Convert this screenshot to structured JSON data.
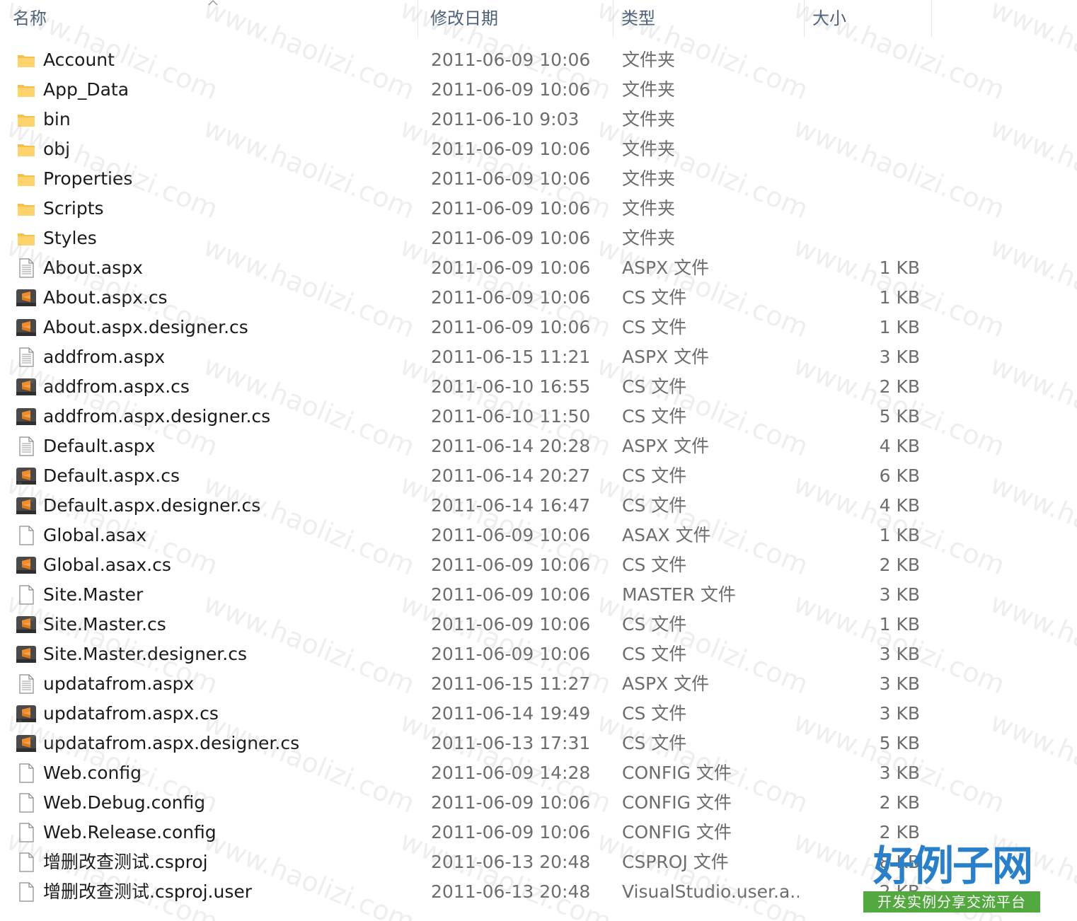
{
  "header": {
    "name": "名称",
    "date": "修改日期",
    "type": "类型",
    "size": "大小"
  },
  "files": [
    {
      "name": "Account",
      "date": "2011-06-09 10:06",
      "type": "文件夹",
      "size": "",
      "icon": "folder-icon"
    },
    {
      "name": "App_Data",
      "date": "2011-06-09 10:06",
      "type": "文件夹",
      "size": "",
      "icon": "folder-icon"
    },
    {
      "name": "bin",
      "date": "2011-06-10 9:03",
      "type": "文件夹",
      "size": "",
      "icon": "folder-icon"
    },
    {
      "name": "obj",
      "date": "2011-06-09 10:06",
      "type": "文件夹",
      "size": "",
      "icon": "folder-icon"
    },
    {
      "name": "Properties",
      "date": "2011-06-09 10:06",
      "type": "文件夹",
      "size": "",
      "icon": "folder-icon"
    },
    {
      "name": "Scripts",
      "date": "2011-06-09 10:06",
      "type": "文件夹",
      "size": "",
      "icon": "folder-icon"
    },
    {
      "name": "Styles",
      "date": "2011-06-09 10:06",
      "type": "文件夹",
      "size": "",
      "icon": "folder-icon"
    },
    {
      "name": "About.aspx",
      "date": "2011-06-09 10:06",
      "type": "ASPX 文件",
      "size": "1 KB",
      "icon": "text-file-icon"
    },
    {
      "name": "About.aspx.cs",
      "date": "2011-06-09 10:06",
      "type": "CS 文件",
      "size": "1 KB",
      "icon": "sublime-file-icon"
    },
    {
      "name": "About.aspx.designer.cs",
      "date": "2011-06-09 10:06",
      "type": "CS 文件",
      "size": "1 KB",
      "icon": "sublime-file-icon"
    },
    {
      "name": "addfrom.aspx",
      "date": "2011-06-15 11:21",
      "type": "ASPX 文件",
      "size": "3 KB",
      "icon": "text-file-icon"
    },
    {
      "name": "addfrom.aspx.cs",
      "date": "2011-06-10 16:55",
      "type": "CS 文件",
      "size": "2 KB",
      "icon": "sublime-file-icon"
    },
    {
      "name": "addfrom.aspx.designer.cs",
      "date": "2011-06-10 11:50",
      "type": "CS 文件",
      "size": "5 KB",
      "icon": "sublime-file-icon"
    },
    {
      "name": "Default.aspx",
      "date": "2011-06-14 20:28",
      "type": "ASPX 文件",
      "size": "4 KB",
      "icon": "text-file-icon"
    },
    {
      "name": "Default.aspx.cs",
      "date": "2011-06-14 20:27",
      "type": "CS 文件",
      "size": "6 KB",
      "icon": "sublime-file-icon"
    },
    {
      "name": "Default.aspx.designer.cs",
      "date": "2011-06-14 16:47",
      "type": "CS 文件",
      "size": "4 KB",
      "icon": "sublime-file-icon"
    },
    {
      "name": "Global.asax",
      "date": "2011-06-09 10:06",
      "type": "ASAX 文件",
      "size": "1 KB",
      "icon": "blank-file-icon"
    },
    {
      "name": "Global.asax.cs",
      "date": "2011-06-09 10:06",
      "type": "CS 文件",
      "size": "2 KB",
      "icon": "sublime-file-icon"
    },
    {
      "name": "Site.Master",
      "date": "2011-06-09 10:06",
      "type": "MASTER 文件",
      "size": "3 KB",
      "icon": "blank-file-icon"
    },
    {
      "name": "Site.Master.cs",
      "date": "2011-06-09 10:06",
      "type": "CS 文件",
      "size": "1 KB",
      "icon": "sublime-file-icon"
    },
    {
      "name": "Site.Master.designer.cs",
      "date": "2011-06-09 10:06",
      "type": "CS 文件",
      "size": "3 KB",
      "icon": "sublime-file-icon"
    },
    {
      "name": "updatafrom.aspx",
      "date": "2011-06-15 11:27",
      "type": "ASPX 文件",
      "size": "3 KB",
      "icon": "text-file-icon"
    },
    {
      "name": "updatafrom.aspx.cs",
      "date": "2011-06-14 19:49",
      "type": "CS 文件",
      "size": "3 KB",
      "icon": "sublime-file-icon"
    },
    {
      "name": "updatafrom.aspx.designer.cs",
      "date": "2011-06-13 17:31",
      "type": "CS 文件",
      "size": "5 KB",
      "icon": "sublime-file-icon"
    },
    {
      "name": "Web.config",
      "date": "2011-06-09 14:28",
      "type": "CONFIG 文件",
      "size": "3 KB",
      "icon": "blank-file-icon"
    },
    {
      "name": "Web.Debug.config",
      "date": "2011-06-09 10:06",
      "type": "CONFIG 文件",
      "size": "2 KB",
      "icon": "blank-file-icon"
    },
    {
      "name": "Web.Release.config",
      "date": "2011-06-09 10:06",
      "type": "CONFIG 文件",
      "size": "2 KB",
      "icon": "blank-file-icon"
    },
    {
      "name": "增删改查测试.csproj",
      "date": "2011-06-13 20:48",
      "type": "CSPROJ 文件",
      "size": "8 KB",
      "icon": "blank-file-icon"
    },
    {
      "name": "增删改查测试.csproj.user",
      "date": "2011-06-13 20:48",
      "type": "VisualStudio.user.a...",
      "size": "2 KB",
      "icon": "blank-file-icon"
    }
  ],
  "watermark": {
    "text": "www.haolizi.com",
    "logo_title": "好例子网",
    "logo_subtitle": "开发实例分享交流平台"
  },
  "colors": {
    "header_text": "#4c607a",
    "folder": "#f5c04a",
    "sublime": "#4a4a4a",
    "sublime_accent": "#f28c28",
    "logo_blue": "#2a7fc9",
    "logo_green": "#53a93f"
  }
}
